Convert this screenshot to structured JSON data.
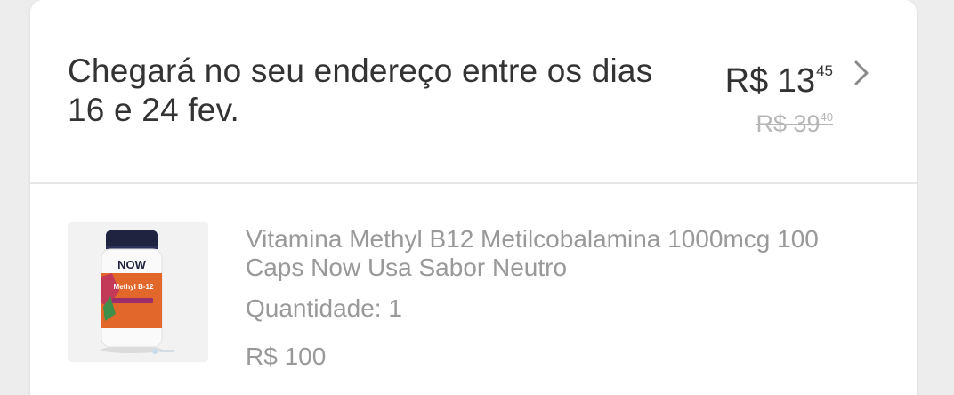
{
  "shipping": {
    "delivery_text": "Chegará no seu endereço entre os dias 16 e 24 fev.",
    "price_current": {
      "whole": "R$ 13",
      "cents": "45"
    },
    "price_original": {
      "whole": "R$ 39",
      "cents": "40"
    },
    "chevron_icon": "chevron-right-icon"
  },
  "product": {
    "title": "Vitamina Methyl B12 Metilcobalamina 1000mcg 100 Caps Now Usa Sabor Neutro",
    "quantity_label": "Quantidade: 1",
    "price": "R$ 100",
    "image_brand": "NOW",
    "image_label": "Methyl B-12"
  },
  "colors": {
    "background": "#ededed",
    "card": "#ffffff",
    "primary_text": "#333333",
    "secondary_text": "#999999",
    "strikethrough_text": "#b6b6b6",
    "divider": "#e6e6e6"
  }
}
